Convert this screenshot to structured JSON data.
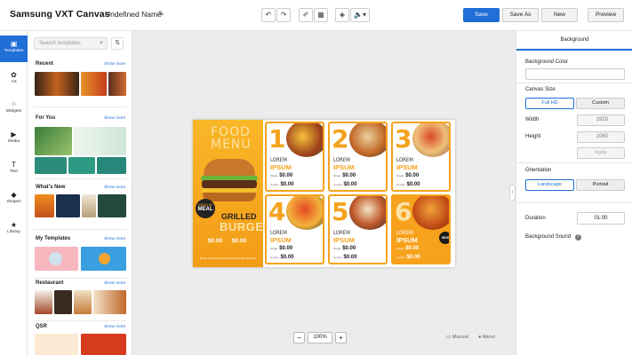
{
  "app_title": "Samsung VXT Canvas",
  "document_name": "Undefined Name",
  "topbar_icons": [
    "undo-icon",
    "redo-icon",
    "ruler-icon",
    "grid-icon",
    "layers-icon",
    "volume-icon"
  ],
  "actions": {
    "save": "Save",
    "save_as": "Save As",
    "new": "New",
    "preview": "Preview"
  },
  "nav": [
    {
      "label": "Templates",
      "icon": "templates-icon"
    },
    {
      "label": "Art",
      "icon": "art-icon"
    },
    {
      "label": "Widgets",
      "icon": "widgets-icon"
    },
    {
      "label": "Media",
      "icon": "media-icon"
    },
    {
      "label": "Text",
      "icon": "text-icon"
    },
    {
      "label": "Shapes",
      "icon": "shapes-icon"
    },
    {
      "label": "Library",
      "icon": "library-icon"
    }
  ],
  "search": {
    "placeholder": "Search templates"
  },
  "sections": [
    {
      "title": "Recent",
      "more": "Show more"
    },
    {
      "title": "For You",
      "more": "Show more"
    },
    {
      "title": "What's New",
      "more": "Show more"
    },
    {
      "title": "My Templates",
      "more": "Show more"
    },
    {
      "title": "Restaurant",
      "more": "Show more"
    },
    {
      "title": "QSR",
      "more": "Show more"
    }
  ],
  "design": {
    "brand_line1": "FOOD",
    "brand_line2": "MENU",
    "badge_line1": "MUNCHIE",
    "badge_line2": "MEAL",
    "grilled": "GRILLED",
    "burger": "BURGER",
    "left_price": "$0.00",
    "footer": "Please don't lose yourself if you have any allergies!",
    "new_badge": "NEW",
    "items": [
      {
        "num": "1",
        "l1": "LOREM",
        "l2": "IPSUM",
        "single": "$0.00",
        "combo": "$0.00"
      },
      {
        "num": "2",
        "l1": "LOREM",
        "l2": "IPSUM",
        "single": "$0.00",
        "combo": "$0.00"
      },
      {
        "num": "3",
        "l1": "LOREM",
        "l2": "IPSUM",
        "single": "$0.00",
        "combo": "$0.00"
      },
      {
        "num": "4",
        "l1": "LOREM",
        "l2": "IPSUM",
        "single": "$0.00",
        "combo": "$0.00"
      },
      {
        "num": "5",
        "l1": "LOREM",
        "l2": "IPSUM",
        "single": "$0.00",
        "combo": "$0.00"
      },
      {
        "num": "6",
        "l1": "LOREM",
        "l2": "IPSUM",
        "single": "$0.00",
        "combo": "$0.00"
      }
    ],
    "single_label": "Single",
    "combo_label": "Combo"
  },
  "zoom": {
    "value": "100%",
    "minus": "−",
    "plus": "+"
  },
  "footer_links": {
    "manual": "Manual",
    "about": "About"
  },
  "right_panel": {
    "tab": "Background",
    "bg_color_label": "Background Color",
    "canvas_size_label": "Canvas Size",
    "full_hd": "Full HD",
    "custom": "Custom",
    "width_label": "Width",
    "width_value": "1920",
    "height_label": "Height",
    "height_value": "1080",
    "apply": "Apply",
    "orientation_label": "Orientation",
    "landscape": "Landscape",
    "portrait": "Portrait",
    "duration_label": "Duration",
    "duration_value": "01:00",
    "bg_sound_label": "Background Sound"
  },
  "colors": {
    "accent": "#1f6fd6",
    "menu_orange": "#f5a31d"
  }
}
